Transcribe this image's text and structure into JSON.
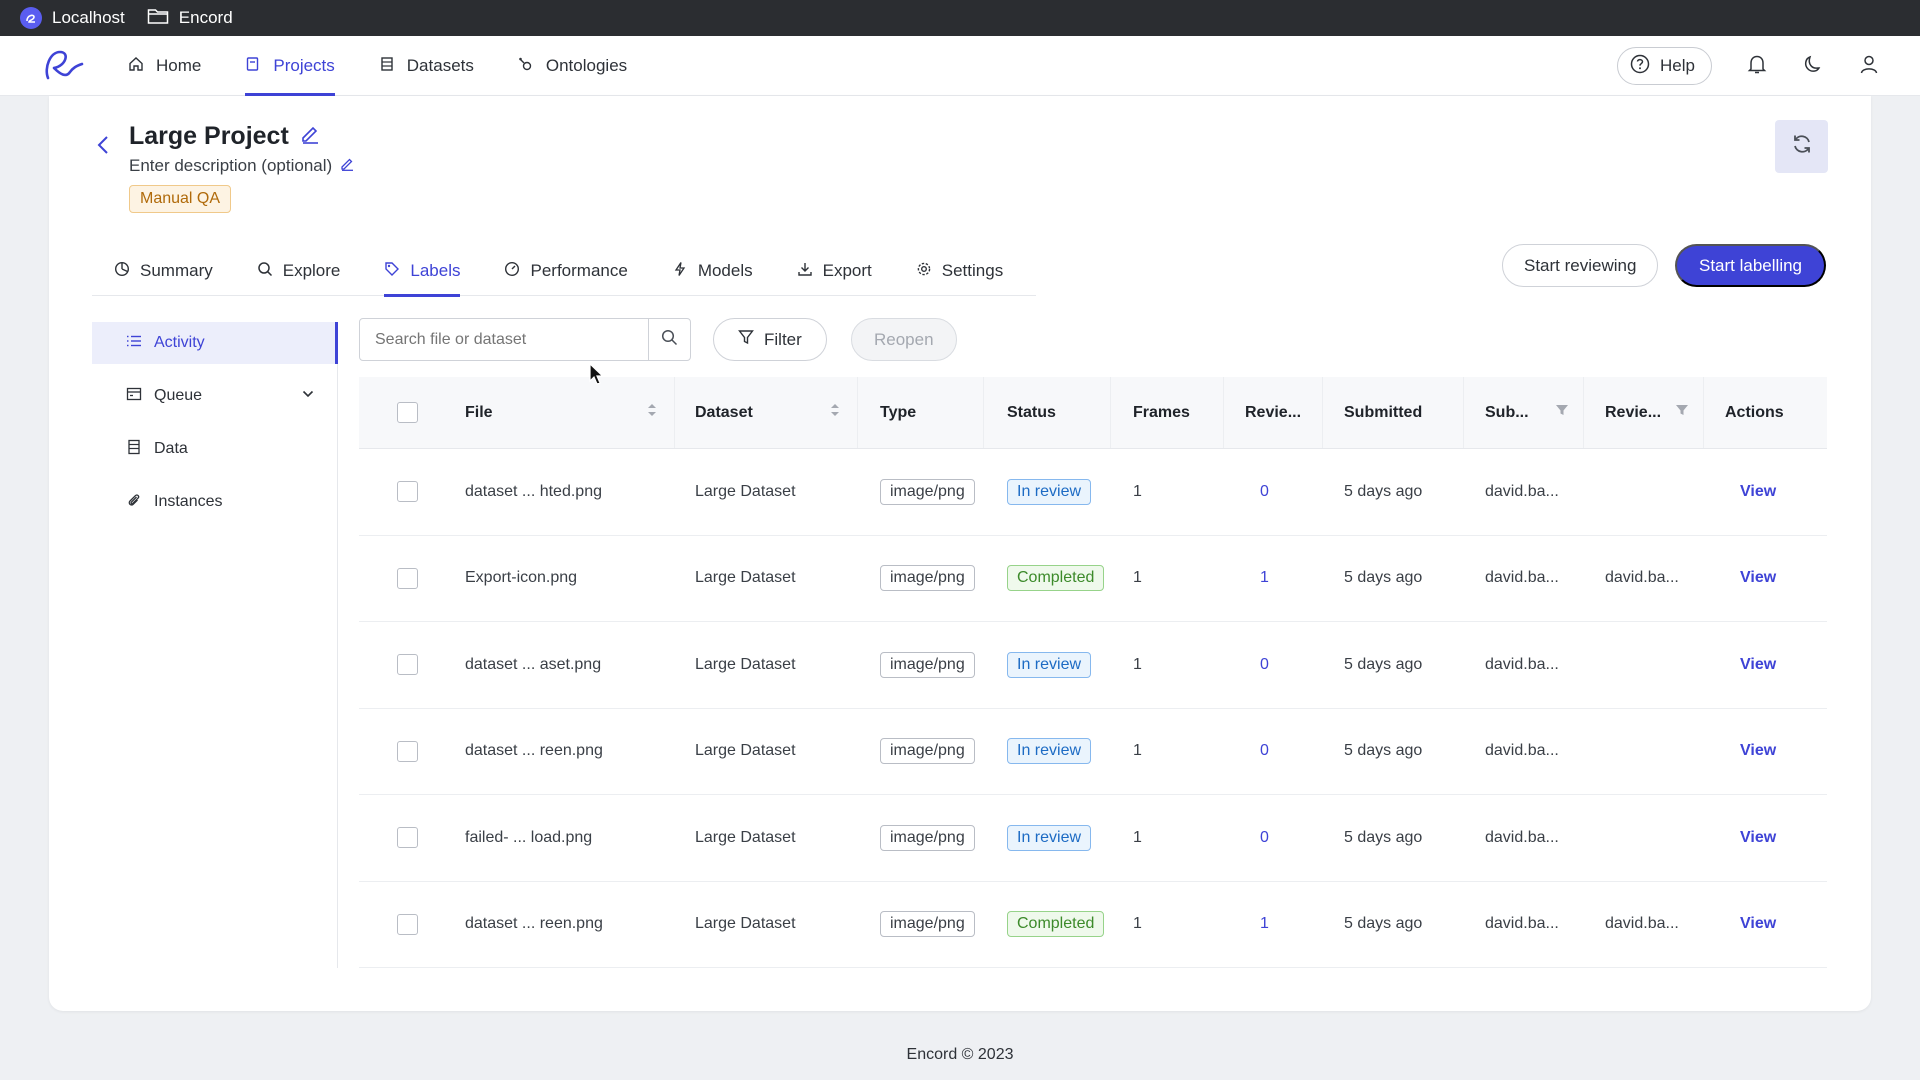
{
  "titlebar": {
    "host": "Localhost",
    "app": "Encord"
  },
  "nav": {
    "items": [
      {
        "label": "Home",
        "icon": "home-icon"
      },
      {
        "label": "Projects",
        "icon": "projects-icon"
      },
      {
        "label": "Datasets",
        "icon": "datasets-icon"
      },
      {
        "label": "Ontologies",
        "icon": "ontologies-icon"
      }
    ],
    "active": "Projects",
    "help_label": "Help"
  },
  "project": {
    "title": "Large Project",
    "description": "Enter description (optional)",
    "badge": "Manual QA"
  },
  "tabs": [
    {
      "label": "Summary",
      "icon": "summary-icon"
    },
    {
      "label": "Explore",
      "icon": "explore-icon"
    },
    {
      "label": "Labels",
      "icon": "labels-icon"
    },
    {
      "label": "Performance",
      "icon": "performance-icon"
    },
    {
      "label": "Models",
      "icon": "models-icon"
    },
    {
      "label": "Export",
      "icon": "export-icon"
    },
    {
      "label": "Settings",
      "icon": "settings-icon"
    }
  ],
  "active_tab": "Labels",
  "actions": {
    "start_reviewing": "Start reviewing",
    "start_labelling": "Start labelling"
  },
  "sidebar": {
    "items": [
      {
        "label": "Activity",
        "icon": "list-icon"
      },
      {
        "label": "Queue",
        "icon": "queue-icon"
      },
      {
        "label": "Data",
        "icon": "data-icon"
      },
      {
        "label": "Instances",
        "icon": "instances-icon"
      }
    ],
    "active": "Activity"
  },
  "toolbar": {
    "search_placeholder": "Search file or dataset",
    "filter_label": "Filter",
    "reopen_label": "Reopen"
  },
  "table": {
    "columns": [
      "File",
      "Dataset",
      "Type",
      "Status",
      "Frames",
      "Revie...",
      "Submitted",
      "Sub...",
      "Revie...",
      "Actions"
    ],
    "rows": [
      {
        "file": "dataset ... hted.png",
        "dataset": "Large Dataset",
        "type": "image/png",
        "status": "In review",
        "frames": "1",
        "reviews": "0",
        "submitted": "5 days ago",
        "submitter": "david.ba...",
        "reviewer": "",
        "action": "View"
      },
      {
        "file": "Export-icon.png",
        "dataset": "Large Dataset",
        "type": "image/png",
        "status": "Completed",
        "frames": "1",
        "reviews": "1",
        "submitted": "5 days ago",
        "submitter": "david.ba...",
        "reviewer": "david.ba...",
        "action": "View"
      },
      {
        "file": "dataset ... aset.png",
        "dataset": "Large Dataset",
        "type": "image/png",
        "status": "In review",
        "frames": "1",
        "reviews": "0",
        "submitted": "5 days ago",
        "submitter": "david.ba...",
        "reviewer": "",
        "action": "View"
      },
      {
        "file": "dataset ... reen.png",
        "dataset": "Large Dataset",
        "type": "image/png",
        "status": "In review",
        "frames": "1",
        "reviews": "0",
        "submitted": "5 days ago",
        "submitter": "david.ba...",
        "reviewer": "",
        "action": "View"
      },
      {
        "file": "failed- ... load.png",
        "dataset": "Large Dataset",
        "type": "image/png",
        "status": "In review",
        "frames": "1",
        "reviews": "0",
        "submitted": "5 days ago",
        "submitter": "david.ba...",
        "reviewer": "",
        "action": "View"
      },
      {
        "file": "dataset ... reen.png",
        "dataset": "Large Dataset",
        "type": "image/png",
        "status": "Completed",
        "frames": "1",
        "reviews": "1",
        "submitted": "5 days ago",
        "submitter": "david.ba...",
        "reviewer": "david.ba...",
        "action": "View"
      }
    ]
  },
  "footer": "Encord © 2023",
  "colors": {
    "accent": "#3e43d6",
    "in_review": "#1d6bc4",
    "completed": "#3c8a2a",
    "badge": "#b06a0a"
  }
}
